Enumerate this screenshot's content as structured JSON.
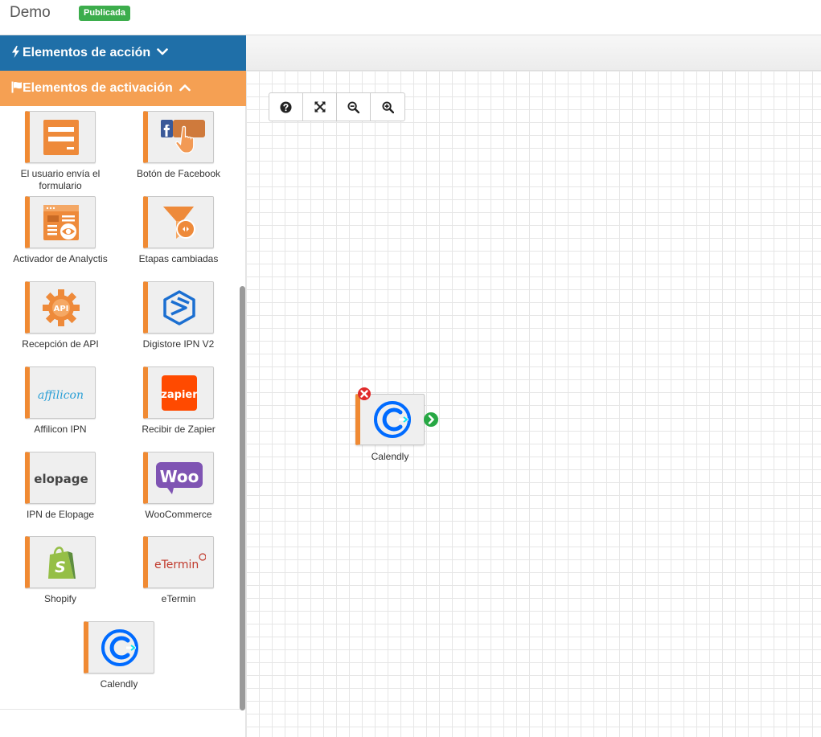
{
  "header": {
    "title": "Demo",
    "status_badge": "Publicada",
    "badge_color": "#3cad4c"
  },
  "sidebar": {
    "action_panel": {
      "label": "Elementos de acción",
      "color": "#1f6fa8",
      "state": "collapsed"
    },
    "trigger_panel": {
      "label": "Elementos de activación",
      "color": "#f5a053",
      "state": "expanded"
    },
    "triggers": [
      {
        "label": "El usuario envía el formulario",
        "icon": "form-icon"
      },
      {
        "label": "Botón de Facebook",
        "icon": "facebook-button-icon"
      },
      {
        "label": "Activador de Analyctis",
        "icon": "analytics-icon"
      },
      {
        "label": "Etapas cambiadas",
        "icon": "funnel-icon"
      },
      {
        "label": "Recepción de API",
        "icon": "api-gear-icon"
      },
      {
        "label": "Digistore IPN V2",
        "icon": "digistore-logo-icon"
      },
      {
        "label": "Affilicon IPN",
        "icon": "affilicon-logo-icon",
        "logo_text": "affilicon"
      },
      {
        "label": "Recibir de Zapier",
        "icon": "zapier-logo-icon",
        "logo_text": "zapier"
      },
      {
        "label": "IPN de Elopage",
        "icon": "elopage-logo-icon",
        "logo_text": "elopage"
      },
      {
        "label": "WooCommerce",
        "icon": "woocommerce-logo-icon",
        "logo_text": "Woo"
      },
      {
        "label": "Shopify",
        "icon": "shopify-logo-icon"
      },
      {
        "label": "eTermin",
        "icon": "etermin-logo-icon",
        "logo_text": "eTermin"
      },
      {
        "label": "Calendly",
        "icon": "calendly-logo-icon"
      }
    ]
  },
  "canvas": {
    "toolbar": [
      {
        "name": "help-button",
        "icon": "question-circle-icon"
      },
      {
        "name": "fit-screen-button",
        "icon": "expand-arrows-icon"
      },
      {
        "name": "zoom-out-button",
        "icon": "zoom-out-icon"
      },
      {
        "name": "zoom-in-button",
        "icon": "zoom-in-icon"
      }
    ],
    "nodes": [
      {
        "label": "Calendly",
        "icon": "calendly-logo-icon"
      }
    ]
  }
}
